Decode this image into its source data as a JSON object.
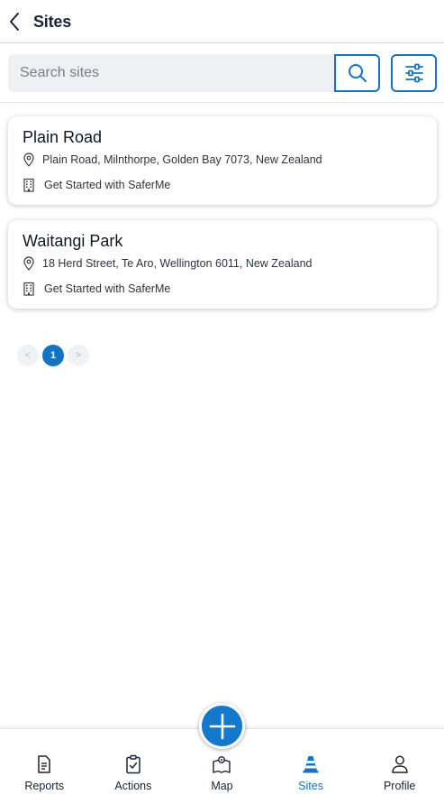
{
  "header": {
    "title": "Sites"
  },
  "search": {
    "placeholder": "Search sites"
  },
  "sites": [
    {
      "name": "Plain Road",
      "address": "Plain Road, Milnthorpe, Golden Bay 7073, New Zealand",
      "type": "Get Started with SaferMe"
    },
    {
      "name": "Waitangi Park",
      "address": "18 Herd Street, Te Aro, Wellington 6011, New Zealand",
      "type": "Get Started with SaferMe"
    }
  ],
  "pagination": {
    "prev": "<",
    "current": "1",
    "next": ">"
  },
  "nav": [
    {
      "label": "Reports",
      "icon": "reports-icon"
    },
    {
      "label": "Actions",
      "icon": "clipboard-check-icon"
    },
    {
      "label": "Map",
      "icon": "map-icon"
    },
    {
      "label": "Sites",
      "icon": "cone-icon",
      "active": true
    },
    {
      "label": "Profile",
      "icon": "person-icon"
    }
  ],
  "colors": {
    "accent": "#1474c4",
    "fab": "#1478cc",
    "search_bg": "#eef0f3"
  },
  "icons": {
    "back": "chevron-left-icon",
    "search": "search-icon",
    "filter": "sliders-icon",
    "address": "map-pin-icon",
    "site_type": "building-icon",
    "fab": "plus-icon"
  }
}
